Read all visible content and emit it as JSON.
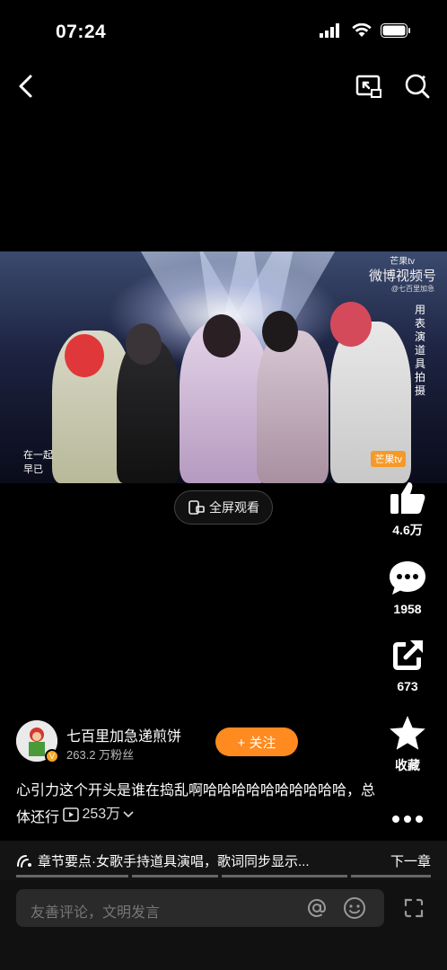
{
  "status_bar": {
    "time": "07:24"
  },
  "video": {
    "watermark_top": "芒果tv",
    "watermark_weibo": "微博视频号",
    "watermark_user": "@七百里加急",
    "vertical_caption": "用表演道具拍摄",
    "lyrics": [
      "在一起",
      "早已"
    ],
    "watermark_bottom": "芒果tv"
  },
  "fullscreen": {
    "label": "全屏观看"
  },
  "actions": {
    "like_count": "4.6万",
    "comment_count": "1958",
    "share_count": "673",
    "favorite_label": "收藏"
  },
  "author": {
    "name": "七百里加急递煎饼",
    "fans": "263.2 万粉丝",
    "follow_label": "+ 关注"
  },
  "caption": {
    "text": "心引力这个开头是谁在捣乱啊哈哈哈哈哈哈哈哈哈哈，总体还行",
    "views": "253万"
  },
  "chapter": {
    "text": "章节要点·女歌手持道具演唱，歌词同步显示...",
    "next": "下一章"
  },
  "comment": {
    "placeholder": "友善评论，文明发言"
  },
  "colors": {
    "accent": "#ff8a1f",
    "background": "#000000"
  }
}
